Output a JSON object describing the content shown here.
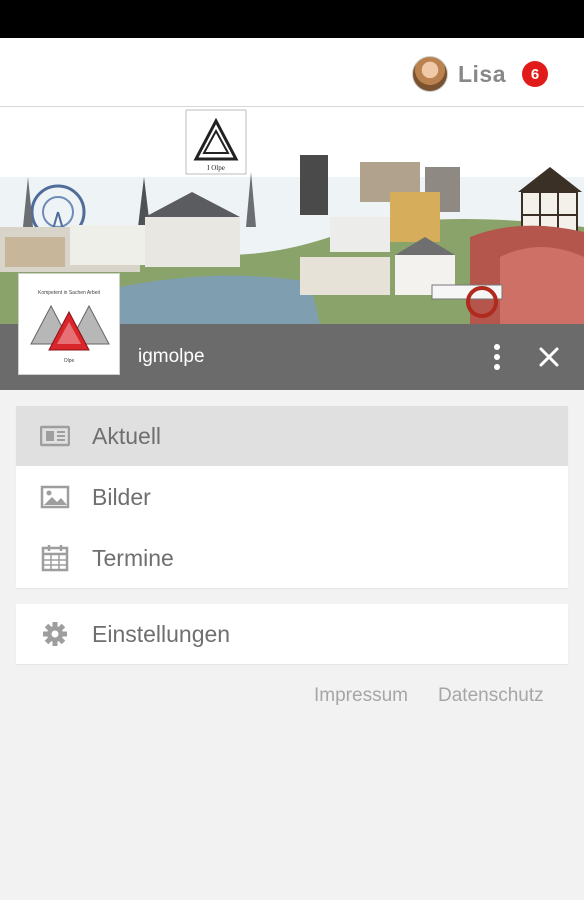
{
  "header": {
    "user_name": "Lisa",
    "notification_count": "6"
  },
  "banner": {
    "logo_caption": "I Olpe",
    "logo_letters": "IGM"
  },
  "profile": {
    "name": "igmolpe",
    "logo_text_top": "Kompetent in Sachen Arbeit",
    "logo_text_bottom": "Olpe"
  },
  "menu": {
    "items": [
      {
        "label": "Aktuell",
        "icon": "newspaper-icon",
        "active": true
      },
      {
        "label": "Bilder",
        "icon": "image-icon",
        "active": false
      },
      {
        "label": "Termine",
        "icon": "calendar-icon",
        "active": false
      }
    ],
    "settings": {
      "label": "Einstellungen",
      "icon": "gear-icon"
    }
  },
  "footer": {
    "impressum": "Impressum",
    "datenschutz": "Datenschutz"
  },
  "colors": {
    "badge": "#e11a1a",
    "profile_bar": "#6b6b6b",
    "active_item": "#e0e0e0",
    "background": "#f2f2f2"
  }
}
